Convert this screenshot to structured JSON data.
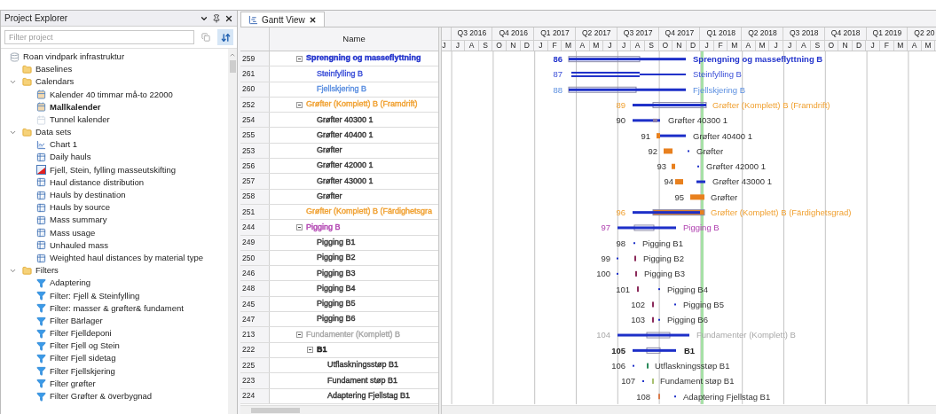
{
  "explorer": {
    "title": "Project Explorer",
    "filter": {
      "placeholder": "Filter project"
    },
    "tree": [
      {
        "label": "Roan vindpark infrastruktur",
        "kind": "database",
        "children": [
          {
            "label": "Baselines",
            "kind": "folder"
          },
          {
            "label": "Calendars",
            "kind": "folder",
            "expanded": true,
            "children": [
              {
                "label": "Kalender 40 timmar må-to 22000",
                "kind": "calendar",
                "bold": false
              },
              {
                "label": "Mallkalender",
                "kind": "calendar",
                "bold": true
              },
              {
                "label": "Tunnel kalender",
                "kind": "calendar-faded",
                "bold": false
              }
            ]
          },
          {
            "label": "Data sets",
            "kind": "folder",
            "expanded": true,
            "children": [
              {
                "label": "Chart 1",
                "kind": "chart"
              },
              {
                "label": "Daily hauls",
                "kind": "table"
              },
              {
                "label": "Fjell, Stein, fylling masseutskifting",
                "kind": "map"
              },
              {
                "label": "Haul distance distribution",
                "kind": "table"
              },
              {
                "label": "Hauls by destination",
                "kind": "table"
              },
              {
                "label": "Hauls by source",
                "kind": "table"
              },
              {
                "label": "Mass summary",
                "kind": "table"
              },
              {
                "label": "Mass usage",
                "kind": "table"
              },
              {
                "label": "Unhauled mass",
                "kind": "table"
              },
              {
                "label": "Weighted haul distances by material type",
                "kind": "table"
              }
            ]
          },
          {
            "label": "Filters",
            "kind": "folder",
            "expanded": true,
            "children": [
              {
                "label": "Adaptering",
                "kind": "filter"
              },
              {
                "label": "Filter: Fjell & Steinfylling",
                "kind": "filter"
              },
              {
                "label": "Filter: masser & grøfter& fundament",
                "kind": "filter"
              },
              {
                "label": "Filter Bärlager",
                "kind": "filter"
              },
              {
                "label": "Filter Fjelldeponi",
                "kind": "filter"
              },
              {
                "label": "Filter Fjell og Stein",
                "kind": "filter"
              },
              {
                "label": "Filter Fjell sidetag",
                "kind": "filter"
              },
              {
                "label": "Filter Fjellskjering",
                "kind": "filter"
              },
              {
                "label": "Filter grøfter",
                "kind": "filter"
              },
              {
                "label": "Filter Grøfter & överbygnad",
                "kind": "filter"
              }
            ]
          }
        ]
      }
    ]
  },
  "gantt": {
    "tab": {
      "label": "Gantt View",
      "selected": true
    },
    "name_header": "Name",
    "quarters": [
      "Q3 2016",
      "Q4 2016",
      "Q1 2017",
      "Q2 2017",
      "Q3 2017",
      "Q4 2017",
      "Q1 2018",
      "Q2 2018",
      "Q3 2018",
      "Q4 2018",
      "Q1 2019",
      "Q2 20"
    ],
    "months": [
      "J",
      "J",
      "A",
      "S",
      "O",
      "N",
      "D",
      "J",
      "F",
      "M",
      "A",
      "M",
      "J",
      "J",
      "A",
      "S",
      "O",
      "N",
      "D",
      "J",
      "F",
      "M",
      "A",
      "M",
      "J",
      "J",
      "A",
      "S",
      "O",
      "N",
      "D",
      "J",
      "F",
      "M",
      "A",
      "M"
    ],
    "rows": [
      {
        "id": "259",
        "name": "Sprengning og masseflyttning",
        "kind": "group",
        "color": "#2233cc",
        "bold": true,
        "bar_number": "86",
        "bar_label": "Sprengning og masseflyttning B",
        "children": [
          {
            "id": "261",
            "name": "Steinfylling B",
            "kind": "task",
            "color": "#3b4fd8",
            "bold": false,
            "bar_number": "87",
            "bar_label": "Steinfylling B"
          },
          {
            "id": "260",
            "name": "Fjellskjering B",
            "kind": "task",
            "color": "#5b8fe0",
            "bold": false,
            "bar_number": "88",
            "bar_label": "Fjellskjering B"
          }
        ]
      },
      {
        "id": "252",
        "name": "Grøfter (Komplett) B (Framdrift)",
        "kind": "group",
        "color": "#f0a030",
        "bold": false,
        "bar_number": "89",
        "bar_label": "Grøfter (Komplett) B (Framdrift)",
        "children": [
          {
            "id": "254",
            "name": "Grøfter 40300 1",
            "kind": "task",
            "color": "#333333",
            "bold": false,
            "bar_number": "90",
            "bar_label": "Grøfter 40300 1"
          },
          {
            "id": "255",
            "name": "Grøfter 40400 1",
            "kind": "task",
            "color": "#333333",
            "bold": false,
            "bar_number": "91",
            "bar_label": "Grøfter 40400 1"
          },
          {
            "id": "253",
            "name": "Grøfter",
            "kind": "task",
            "color": "#333333",
            "bold": false,
            "bar_number": "92",
            "bar_label": "Grøfter"
          },
          {
            "id": "256",
            "name": "Grøfter 42000 1",
            "kind": "task",
            "color": "#333333",
            "bold": false,
            "bar_number": "93",
            "bar_label": "Grøfter 42000 1"
          },
          {
            "id": "257",
            "name": "Grøfter 43000 1",
            "kind": "task",
            "color": "#333333",
            "bold": false,
            "bar_number": "94",
            "bar_label": "Grøfter 43000 1"
          },
          {
            "id": "258",
            "name": "Grøfter",
            "kind": "task",
            "color": "#333333",
            "bold": false,
            "bar_number": "95",
            "bar_label": "Grøfter"
          }
        ]
      },
      {
        "id": "251",
        "name": "Grøfter (Komplett) B (Färdighetsgra",
        "kind": "task",
        "color": "#f0a030",
        "bold": false,
        "bar_number": "96",
        "bar_label": "Grøfter (Komplett) B (Färdighetsgrad)"
      },
      {
        "id": "244",
        "name": "Pigging B",
        "kind": "group",
        "color": "#b040b0",
        "bold": false,
        "bar_number": "97",
        "bar_label": "Pigging B",
        "children": [
          {
            "id": "249",
            "name": "Pigging B1",
            "kind": "task",
            "color": "#333333",
            "bold": false,
            "bar_number": "98",
            "bar_label": "Pigging B1"
          },
          {
            "id": "250",
            "name": "Pigging B2",
            "kind": "task",
            "color": "#333333",
            "bold": false,
            "bar_number": "99",
            "bar_label": "Pigging B2"
          },
          {
            "id": "246",
            "name": "Pigging B3",
            "kind": "task",
            "color": "#333333",
            "bold": false,
            "bar_number": "100",
            "bar_label": "Pigging B3"
          },
          {
            "id": "248",
            "name": "Pigging B4",
            "kind": "task",
            "color": "#333333",
            "bold": false,
            "bar_number": "101",
            "bar_label": "Pigging B4"
          },
          {
            "id": "245",
            "name": "Pigging B5",
            "kind": "task",
            "color": "#333333",
            "bold": false,
            "bar_number": "102",
            "bar_label": "Pigging B5"
          },
          {
            "id": "247",
            "name": "Pigging B6",
            "kind": "task",
            "color": "#333333",
            "bold": false,
            "bar_number": "103",
            "bar_label": "Pigging B6"
          }
        ]
      },
      {
        "id": "213",
        "name": "Fundamenter (Komplett) B",
        "kind": "group",
        "color": "#a8a8a8",
        "bold": false,
        "bar_number": "104",
        "bar_label": "Fundamenter (Komplett) B",
        "children": [
          {
            "id": "222",
            "name": "B1",
            "kind": "group",
            "color": "#222222",
            "bold": true,
            "bar_number": "105",
            "bar_label": "B1",
            "children": [
              {
                "id": "225",
                "name": "Utflaskningsstøp B1",
                "kind": "task",
                "color": "#333333",
                "bold": false,
                "bar_number": "106",
                "bar_label": "Utflaskningsstøp B1"
              },
              {
                "id": "223",
                "name": "Fundament støp B1",
                "kind": "task",
                "color": "#333333",
                "bold": false,
                "bar_number": "107",
                "bar_label": "Fundament støp B1"
              },
              {
                "id": "224",
                "name": "Adaptering Fjellstag B1",
                "kind": "task",
                "color": "#333333",
                "bold": false,
                "bar_number": "108",
                "bar_label": "Adaptering Fjellstag B1"
              }
            ]
          }
        ]
      }
    ]
  }
}
